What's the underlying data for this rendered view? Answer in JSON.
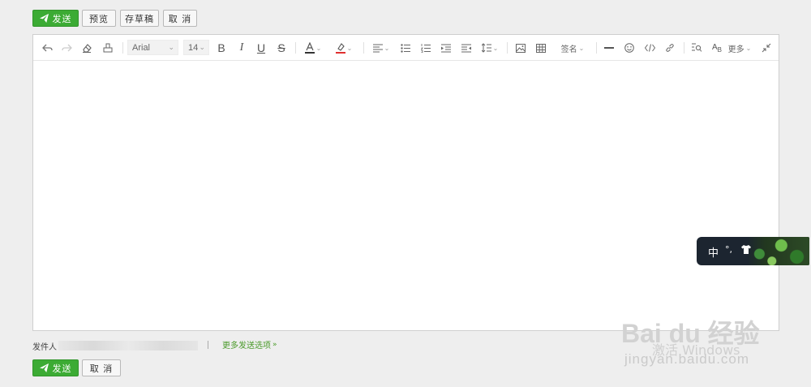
{
  "top_toolbar": {
    "send_label": "发送",
    "preview_label": "预览",
    "draft_label": "存草稿",
    "cancel_label": "取 消"
  },
  "editor_toolbar": {
    "font_family": "Arial",
    "font_size": "14",
    "signature_label": "签名",
    "more_label": "更多",
    "icons": [
      "undo-icon",
      "redo-icon",
      "eraser-icon",
      "format-painter-icon",
      "bold-icon",
      "italic-icon",
      "underline-icon",
      "strikethrough-icon",
      "font-color-icon",
      "highlight-icon",
      "align-icon",
      "bullet-list-icon",
      "numbered-list-icon",
      "indent-icon",
      "outdent-icon",
      "line-height-icon",
      "image-icon",
      "table-icon",
      "horizontal-rule-icon",
      "emoji-icon",
      "code-icon",
      "link-icon",
      "find-icon",
      "case-icon",
      "collapse-icon"
    ],
    "colors": {
      "font_color": "#333333",
      "highlight": "#e03030"
    }
  },
  "footer": {
    "sender_label": "发件人",
    "more_options_label": "更多发送选项",
    "send_label": "发送",
    "cancel_label": "取 消"
  },
  "ime": {
    "mode": "中",
    "punct": "°,"
  },
  "watermark": {
    "brand": "Bai du 经验",
    "url": "jingyan.baidu.com",
    "activate": "激活 Windows"
  },
  "colors": {
    "primary": "#3cab34",
    "link": "#4a9a2a",
    "border": "#cfcfcf"
  }
}
